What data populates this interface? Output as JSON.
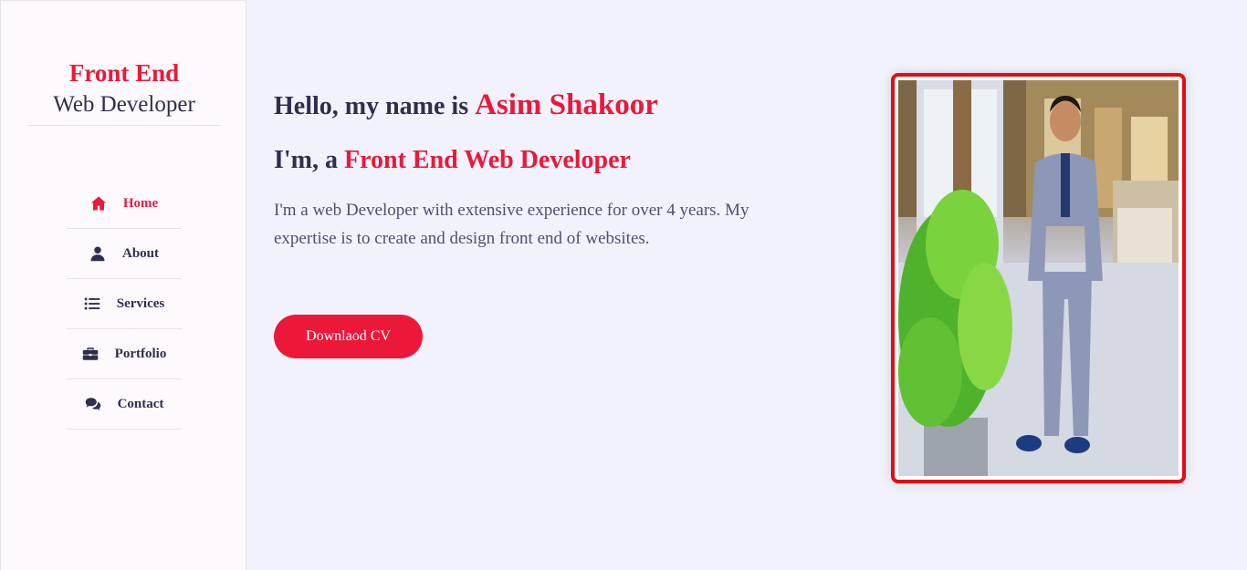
{
  "sidebar": {
    "logo_line1": "Front End",
    "logo_line2": "Web Developer",
    "nav": [
      {
        "label": "Home",
        "icon": "home-icon",
        "active": true
      },
      {
        "label": "About",
        "icon": "user-icon",
        "active": false
      },
      {
        "label": "Services",
        "icon": "list-icon",
        "active": false
      },
      {
        "label": "Portfolio",
        "icon": "briefcase-icon",
        "active": false
      },
      {
        "label": "Contact",
        "icon": "chat-icon",
        "active": false
      }
    ]
  },
  "hero": {
    "greeting": "Hello, my name is ",
    "name": "Asim Shakoor",
    "role_prefix": "I'm, a ",
    "role": "Front End Web Developer",
    "description": "I'm a web Developer with extensive experience for over 4 years. My expertise is to create and design front end of websites.",
    "cta_label": "Downlaod CV",
    "photo_alt": "Asim Shakoor"
  },
  "colors": {
    "accent": "#ec1839",
    "text": "#302e4d",
    "sidebar_bg": "#fdf9ff",
    "page_bg": "#f2f2fc",
    "photo_border": "#e20d13"
  }
}
